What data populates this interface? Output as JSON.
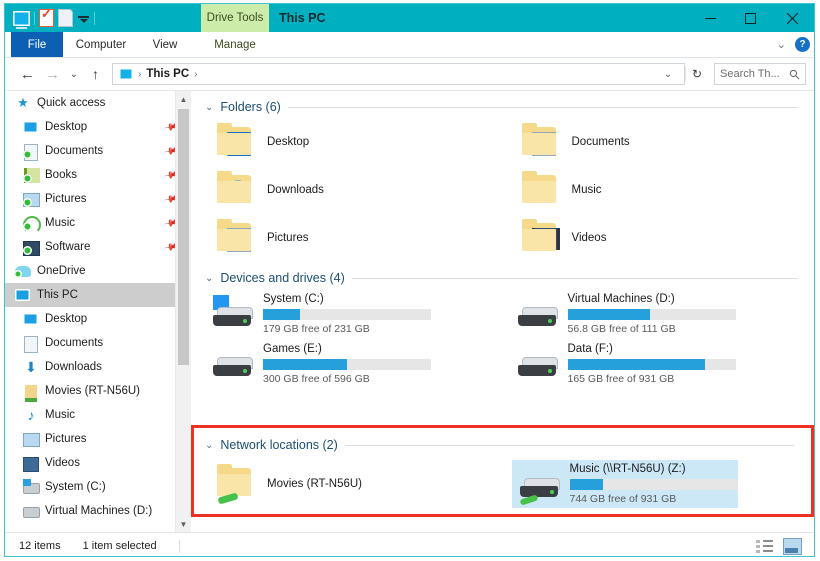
{
  "window": {
    "title": "This PC",
    "contextual_tab": "Drive Tools",
    "minimize": "–",
    "maximize": "□",
    "close": "✕"
  },
  "quick_access_toolbar": {
    "items": [
      {
        "name": "this-pc-icon",
        "label": "This PC"
      },
      {
        "name": "properties-icon",
        "label": "Properties"
      },
      {
        "name": "new-folder-icon",
        "label": "New folder"
      },
      {
        "name": "customize-caret-icon",
        "label": "Customize Quick Access Toolbar"
      }
    ]
  },
  "ribbon": {
    "tabs": [
      {
        "label": "File"
      },
      {
        "label": "Computer"
      },
      {
        "label": "View"
      },
      {
        "label": "Manage"
      }
    ],
    "collapse_chevron": "⌄",
    "help_label": "?"
  },
  "address_bar": {
    "back": "←",
    "forward": "→",
    "history": "⌄",
    "up": "↑",
    "crumb_icon": "this-pc-icon",
    "crumb": "This PC",
    "crumb_sep": "›",
    "dropdown": "⌄",
    "refresh": "↻"
  },
  "search": {
    "placeholder": "Search Th...",
    "icon": "🔎"
  },
  "sidebar": {
    "items": [
      {
        "label": "Quick access",
        "icon": "star-icon",
        "pinned": false,
        "indent": "root",
        "selected": false
      },
      {
        "label": "Desktop",
        "icon": "desktop-monitor-icon",
        "pinned": true,
        "selected": false
      },
      {
        "label": "Documents",
        "icon": "documents-synced-icon",
        "pinned": true,
        "selected": false
      },
      {
        "label": "Books",
        "icon": "books-synced-icon",
        "pinned": true,
        "selected": false
      },
      {
        "label": "Pictures",
        "icon": "pictures-synced-icon",
        "pinned": true,
        "selected": false
      },
      {
        "label": "Music",
        "icon": "music-synced-icon",
        "pinned": true,
        "selected": false
      },
      {
        "label": "Software",
        "icon": "software-synced-icon",
        "pinned": true,
        "selected": false
      },
      {
        "label": "OneDrive",
        "icon": "onedrive-icon",
        "pinned": false,
        "indent": "root",
        "selected": false
      },
      {
        "label": "This PC",
        "icon": "this-pc-icon",
        "pinned": false,
        "indent": "root",
        "selected": true
      },
      {
        "label": "Desktop",
        "icon": "desktop-monitor-icon",
        "pinned": false,
        "selected": false
      },
      {
        "label": "Documents",
        "icon": "documents-icon",
        "pinned": false,
        "selected": false
      },
      {
        "label": "Downloads",
        "icon": "downloads-icon",
        "pinned": false,
        "selected": false
      },
      {
        "label": "Movies (RT-N56U)",
        "icon": "network-folder-icon",
        "pinned": false,
        "selected": false
      },
      {
        "label": "Music",
        "icon": "music-note-icon",
        "pinned": false,
        "selected": false
      },
      {
        "label": "Pictures",
        "icon": "pictures-icon",
        "pinned": false,
        "selected": false
      },
      {
        "label": "Videos",
        "icon": "videos-icon",
        "pinned": false,
        "selected": false
      },
      {
        "label": "System (C:)",
        "icon": "windows-drive-icon",
        "pinned": false,
        "selected": false
      },
      {
        "label": "Virtual Machines (D:)",
        "icon": "drive-icon",
        "pinned": false,
        "selected": false
      }
    ]
  },
  "main": {
    "groups": [
      {
        "title": "Folders (6)",
        "chevron": "⌄"
      },
      {
        "title": "Devices and drives (4)",
        "chevron": "⌄"
      },
      {
        "title": "Network locations (2)",
        "chevron": "⌄"
      }
    ],
    "folders": [
      {
        "label": "Desktop",
        "icon": "folder-desktop-icon"
      },
      {
        "label": "Documents",
        "icon": "folder-documents-icon"
      },
      {
        "label": "Downloads",
        "icon": "folder-downloads-icon"
      },
      {
        "label": "Music",
        "icon": "folder-music-icon"
      },
      {
        "label": "Pictures",
        "icon": "folder-pictures-icon"
      },
      {
        "label": "Videos",
        "icon": "folder-videos-icon"
      }
    ],
    "drives": [
      {
        "name": "System (C:)",
        "free": "179 GB free of 231 GB",
        "used_pct": 22,
        "icon": "windows-drive-icon"
      },
      {
        "name": "Virtual Machines (D:)",
        "free": "56.8 GB free of 111 GB",
        "used_pct": 49,
        "icon": "drive-icon"
      },
      {
        "name": "Games (E:)",
        "free": "300 GB free of 596 GB",
        "used_pct": 50,
        "icon": "drive-icon"
      },
      {
        "name": "Data (F:)",
        "free": "165 GB free of 931 GB",
        "used_pct": 82,
        "icon": "drive-icon"
      }
    ],
    "network": [
      {
        "name": "Movies (RT-N56U)",
        "icon": "network-folder-icon",
        "selected": false,
        "has_bar": false
      },
      {
        "name": "Music (\\\\RT-N56U) (Z:)",
        "free": "744 GB free of 931 GB",
        "used_pct": 20,
        "icon": "network-drive-icon",
        "selected": true,
        "has_bar": true
      }
    ]
  },
  "status_bar": {
    "item_count": "12 items",
    "selection": "1 item selected",
    "view_details": "details-view-button",
    "view_tiles": "large-icons-view-button"
  },
  "colors": {
    "accent_teal": "#00b0c0",
    "file_tab_blue": "#0c5fb3",
    "contextual_green": "#ccecaa",
    "highlight_red": "#ee3124",
    "selection_blue": "#cce8f7",
    "bar_blue": "#26a0da"
  }
}
